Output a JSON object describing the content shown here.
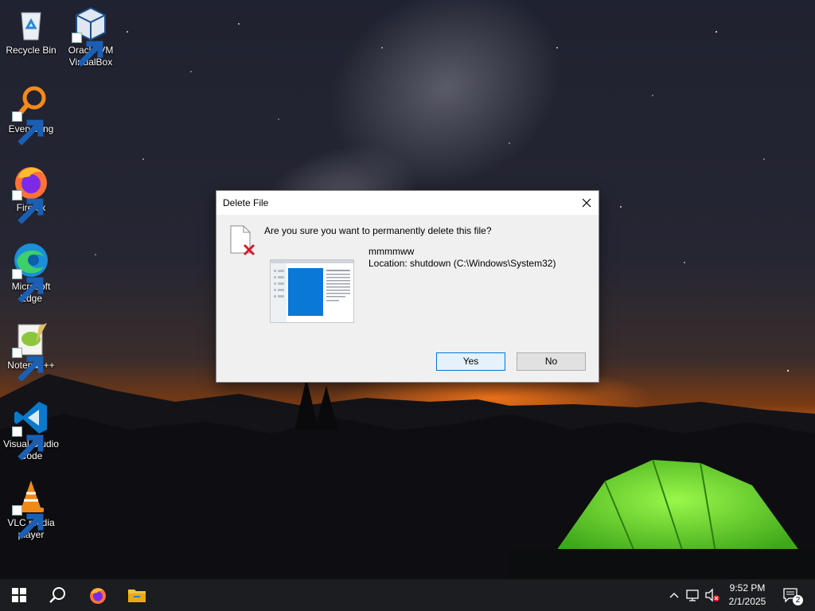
{
  "desktop": {
    "icons": [
      {
        "label": "Recycle Bin"
      },
      {
        "label": "Oracle VM VirtualBox"
      },
      {
        "label": "Everything"
      },
      {
        "label": "Firefox"
      },
      {
        "label": "Microsoft Edge"
      },
      {
        "label": "Notepad++"
      },
      {
        "label": "Visual Studio Code"
      },
      {
        "label": "VLC media player"
      }
    ]
  },
  "dialog": {
    "title": "Delete File",
    "question": "Are you sure you want to permanently delete this file?",
    "file_name": "mmmmww",
    "location": "Location: shutdown (C:\\Windows\\System32)",
    "yes_label": "Yes",
    "no_label": "No",
    "icons": {
      "file": "file-delete-icon",
      "close": "close-icon"
    }
  },
  "taskbar": {
    "pinned": [
      {
        "name": "start-button",
        "icon": "windows-logo-icon"
      },
      {
        "name": "search-button",
        "icon": "search-icon"
      },
      {
        "name": "firefox-taskbar",
        "icon": "firefox-icon"
      },
      {
        "name": "file-explorer-taskbar",
        "icon": "folder-icon"
      }
    ],
    "tray": {
      "time": "9:52 PM",
      "date": "2/1/2025",
      "notification_count": "2"
    }
  },
  "colors": {
    "accent": "#0078d7",
    "taskbar": "#1b1d20",
    "tent_green": "#5fe02a"
  }
}
